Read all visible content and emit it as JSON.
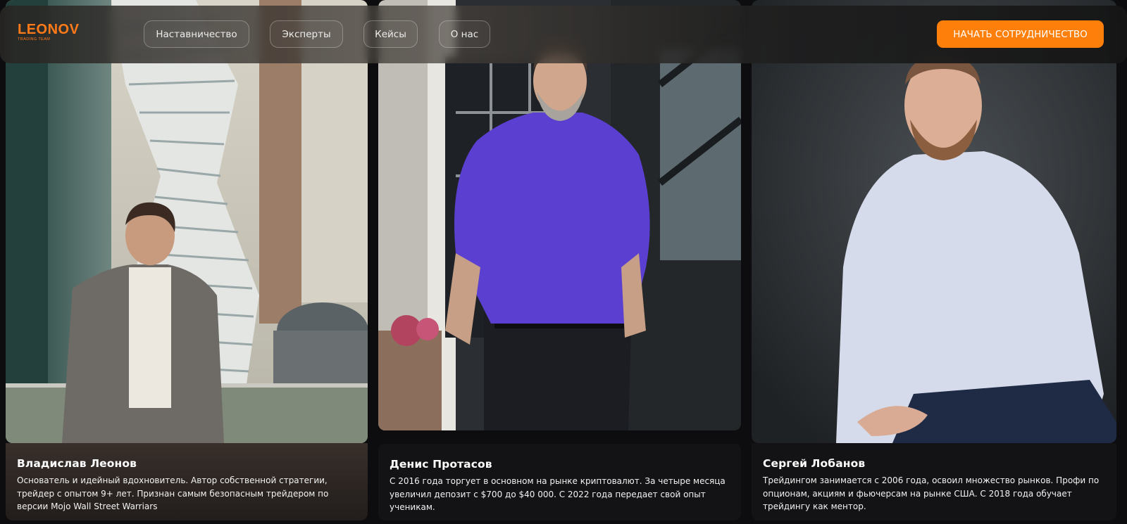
{
  "header": {
    "logo": {
      "name": "LEONOV",
      "tagline": "TRADING TEAM"
    },
    "nav": [
      {
        "label": "Наставничество"
      },
      {
        "label": "Эксперты"
      },
      {
        "label": "Кейсы"
      },
      {
        "label": "О нас"
      }
    ],
    "cta_label": "НАЧАТЬ СОТРУДНИЧЕСТВО"
  },
  "experts": [
    {
      "name": "Владислав Леонов",
      "bio": "Основатель и идейный вдохновитель. Автор собственной стратегии, трейдер с опытом 9+ лет. Признан самым безопасным трейдером по версии Mojo Wall Street Warriars"
    },
    {
      "name": "Денис Протасов",
      "bio": "С 2016 года торгует в основном на рынке криптовалют. За четыре месяца увеличил депозит с $700 до $40 000. С 2022 года передает свой опыт ученикам."
    },
    {
      "name": "Сергей Лобанов",
      "bio": "Трейдингом занимается с 2006 года, освоил множество рынков. Профи по опционам, акциям и фьючерсам на рынке США. С 2018 года обучает трейдингу как ментор."
    }
  ],
  "colors": {
    "accent": "#ff7f0b",
    "background": "#0d0d0f",
    "card": "#131315"
  }
}
